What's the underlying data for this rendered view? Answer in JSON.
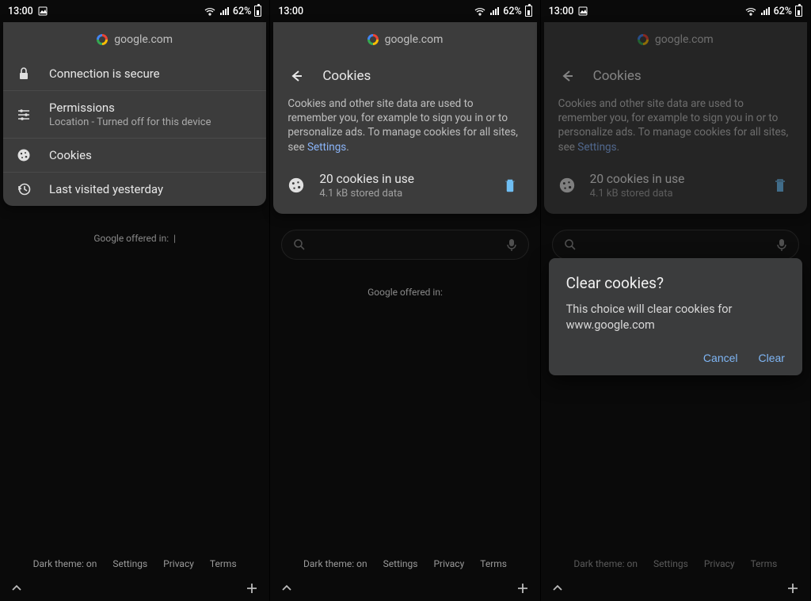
{
  "status": {
    "time": "13:00",
    "battery_text": "62%"
  },
  "site_domain": "google.com",
  "screen1": {
    "row_secure": "Connection is secure",
    "row_permissions": "Permissions",
    "row_permissions_sub": "Location - Turned off for this device",
    "row_cookies": "Cookies",
    "row_history": "Last visited yesterday"
  },
  "cookies_screen": {
    "title": "Cookies",
    "desc_a": "Cookies and other site data are used to remember you, for example to sign you in or to personalize ads. To manage cookies for all sites, see ",
    "desc_link": "Settings",
    "desc_end": ".",
    "count_line": "20 cookies in use",
    "size_line": "4.1 kB stored data"
  },
  "dialog": {
    "title": "Clear cookies?",
    "body": "This choice will clear cookies for www.google.com",
    "cancel": "Cancel",
    "clear": "Clear"
  },
  "page": {
    "offered": "Google offered in:",
    "footer_dark": "Dark theme: on",
    "footer_settings": "Settings",
    "footer_privacy": "Privacy",
    "footer_terms": "Terms"
  }
}
